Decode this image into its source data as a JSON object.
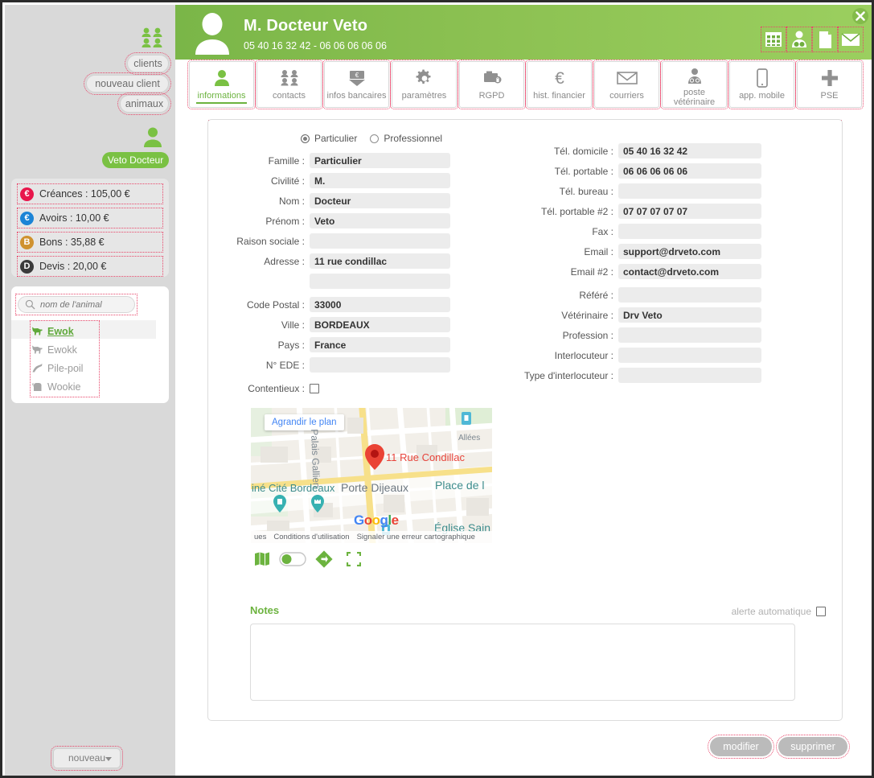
{
  "sidebar": {
    "group_icon": "people-group-icon",
    "buttons": [
      {
        "label": "clients",
        "name": "clients-button"
      },
      {
        "label": "nouveau client",
        "name": "nouveau-client-button"
      },
      {
        "label": "animaux",
        "name": "animaux-button"
      }
    ],
    "user": {
      "icon": "person-icon",
      "name_pill": "Veto Docteur"
    },
    "balances": [
      {
        "badge": "€",
        "label": "Créances : 105,00 €",
        "color": "#e8174c"
      },
      {
        "badge": "€",
        "label": "Avoirs : 10,00 €",
        "color": "#1b84d6"
      },
      {
        "badge": "B",
        "label": "Bons : 35,88 €",
        "color": "#cf922f"
      },
      {
        "badge": "D",
        "label": "Devis : 20,00 €",
        "color": "#3b3b3b"
      }
    ],
    "search": {
      "placeholder": "nom de l'animal",
      "value": "",
      "icon": "search-icon"
    },
    "animals": [
      {
        "label": "Ewok",
        "selected": true,
        "icon": "dog-icon"
      },
      {
        "label": "Ewokk",
        "selected": false,
        "icon": "dog-icon"
      },
      {
        "label": "Pile-poil",
        "selected": false,
        "icon": "cat-icon"
      },
      {
        "label": "Wookie",
        "selected": false,
        "icon": "animal-icon"
      }
    ],
    "nouveau_button": "nouveau"
  },
  "header": {
    "title": "M. Docteur Veto",
    "subtitle": "05 40 16 32 42 - 06 06 06 06 06",
    "avatar": "avatar-icon",
    "close_label": "✕",
    "icons": [
      {
        "name": "calendar-icon"
      },
      {
        "name": "veterinarian-icon"
      },
      {
        "name": "document-icon"
      },
      {
        "name": "envelope-icon"
      }
    ],
    "accent_color": "#7ac143"
  },
  "tabs": [
    {
      "label": "informations",
      "icon": "person-icon",
      "active": true
    },
    {
      "label": "contacts",
      "icon": "contacts-icon",
      "active": false
    },
    {
      "label": "infos bancaires",
      "icon": "bank-card-icon",
      "active": false
    },
    {
      "label": "paramètres",
      "icon": "gear-icon",
      "active": false
    },
    {
      "label": "RGPD",
      "icon": "lock-folder-icon",
      "active": false
    },
    {
      "label": "hist. financier",
      "icon": "euro-icon",
      "active": false
    },
    {
      "label": "courriers",
      "icon": "envelope-icon",
      "active": false
    },
    {
      "label": "poste vétérinaire",
      "icon": "veterinarian-icon",
      "active": false
    },
    {
      "label": "app. mobile",
      "icon": "smartphone-icon",
      "active": false
    },
    {
      "label": "PSE",
      "icon": "plus-icon",
      "active": false
    }
  ],
  "form": {
    "type_particulier": "Particulier",
    "type_professionnel": "Professionnel",
    "type_selected": "Particulier",
    "left": [
      {
        "label": "Famille :",
        "value": "Particulier"
      },
      {
        "label": "Civilité :",
        "value": "M."
      },
      {
        "label": "Nom :",
        "value": "Docteur"
      },
      {
        "label": "Prénom :",
        "value": "Veto"
      },
      {
        "label": "Raison sociale :",
        "value": ""
      },
      {
        "label": "Adresse :",
        "value": "11 rue condillac"
      },
      {
        "label": "",
        "value": ""
      },
      {
        "label": "Code Postal :",
        "value": "33000"
      },
      {
        "label": "Ville :",
        "value": "BORDEAUX"
      },
      {
        "label": "Pays :",
        "value": "France"
      },
      {
        "label": "N° EDE :",
        "value": ""
      }
    ],
    "contentieux_label": "Contentieux :",
    "contentieux_checked": false,
    "right": [
      {
        "label": "Tél. domicile :",
        "value": "05 40 16 32 42"
      },
      {
        "label": "Tél. portable :",
        "value": "06 06 06 06 06"
      },
      {
        "label": "Tél. bureau :",
        "value": ""
      },
      {
        "label": "Tél. portable #2 :",
        "value": "07 07 07 07 07"
      },
      {
        "label": "Fax :",
        "value": ""
      },
      {
        "label": "Email :",
        "value": "support@drveto.com"
      },
      {
        "label": "Email  #2 :",
        "value": "contact@drveto.com"
      },
      {
        "label": "Référé :",
        "value": ""
      },
      {
        "label": "Vétérinaire :",
        "value": "Drv Veto"
      },
      {
        "label": "Profession :",
        "value": ""
      },
      {
        "label": "Interlocuteur :",
        "value": ""
      },
      {
        "label": "Type d'interlocuteur :",
        "value": ""
      }
    ]
  },
  "map": {
    "expand_label": "Agrandir le plan",
    "marker_label": "11 Rue Condillac",
    "streets": [
      "Palais Gallien",
      "Allées",
      "iné Cité Bordeaux",
      "Porte Dijeaux",
      "Place de l",
      "Église Sain"
    ],
    "logo": "Google",
    "footer": [
      "ues",
      "Conditions d'utilisation",
      "Signaler une erreur cartographique"
    ],
    "controls": [
      {
        "name": "map-layer-icon"
      },
      {
        "name": "toggle-switch"
      },
      {
        "name": "directions-icon"
      },
      {
        "name": "fullscreen-icon"
      }
    ]
  },
  "notes": {
    "title": "Notes",
    "alert_label": "alerte automatique",
    "alert_checked": false,
    "value": "",
    "placeholder": ""
  },
  "footer": {
    "modifier": "modifier",
    "supprimer": "supprimer"
  }
}
